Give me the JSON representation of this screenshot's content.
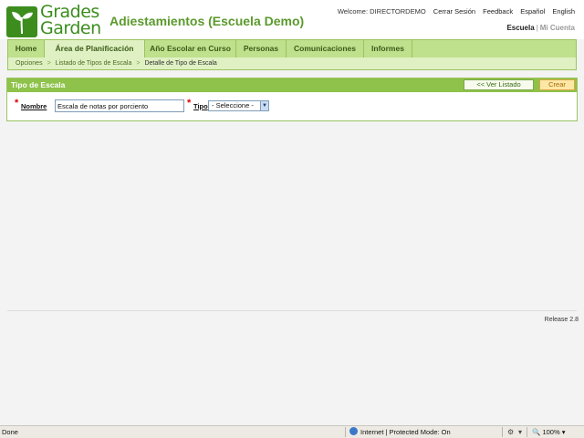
{
  "logo": {
    "line1": "Grades",
    "line2": "Garden"
  },
  "header": {
    "title": "Adiestamientos (Escuela Demo)",
    "welcome": "Welcome: DIRECTORDEMO",
    "links": [
      "Cerrar Sesión",
      "Feedback",
      "Español",
      "English"
    ],
    "scope_active": "Escuela",
    "scope_sep": "|",
    "scope_inactive": "Mi Cuenta"
  },
  "nav": {
    "tabs": [
      {
        "label": "Home"
      },
      {
        "label": "Área de Planificación"
      },
      {
        "label": "Año Escolar en Curso"
      },
      {
        "label": "Personas"
      },
      {
        "label": "Comunicaciones"
      },
      {
        "label": "Informes"
      }
    ],
    "active_index": 1
  },
  "breadcrumb": {
    "items": [
      "Opciones",
      "Listado de Tipos de Escala",
      "Detalle de Tipo de Escala"
    ],
    "separator": ">"
  },
  "panel": {
    "title": "Tipo de Escala",
    "list_button": "<< Ver Listado",
    "create_button": "Crear"
  },
  "form": {
    "required_mark": "*",
    "name_label": "Nombre",
    "name_value": "Escala de notas por porciento",
    "type_label": "Tipo",
    "type_value": "- Seleccione -"
  },
  "footer": {
    "release": "Release 2.8"
  },
  "statusbar": {
    "left": "Done",
    "zone": "Internet | Protected Mode: On",
    "zoom": "100%"
  },
  "colors": {
    "brand_green": "#3c8d1e",
    "nav_green": "#bfe08c",
    "panel_header": "#8ec24a",
    "required": "#e00000",
    "create_button": "#fde7a6"
  }
}
